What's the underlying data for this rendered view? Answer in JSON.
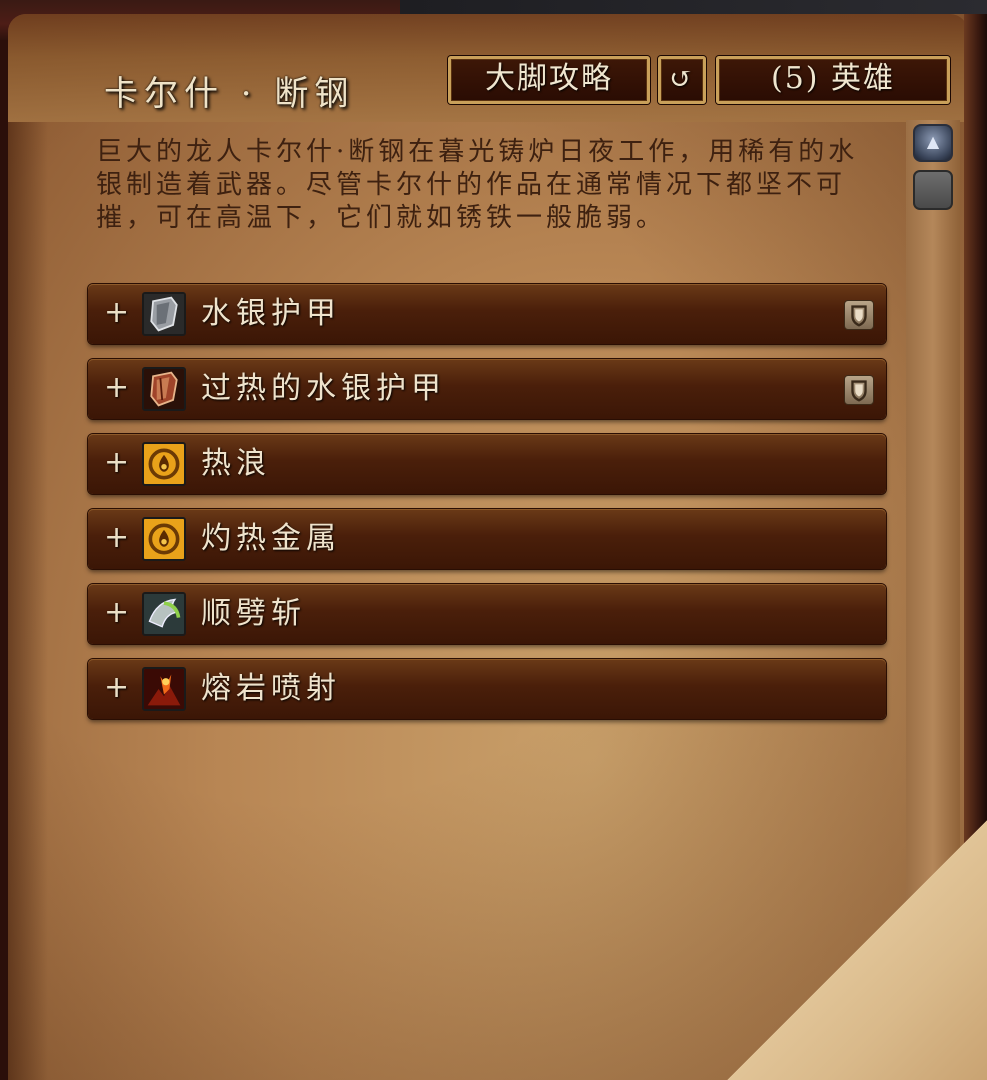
{
  "header": {
    "title": "卡尔什 · 断钢",
    "guide_button": "大脚攻略",
    "reset_button_icon": "↺",
    "difficulty_button": "(5) 英雄"
  },
  "description": "巨大的龙人卡尔什·断钢在暮光铸炉日夜工作，用稀有的水银制造着武器。尽管卡尔什的作品在通常情况下都坚不可摧，可在高温下，它们就如锈铁一般脆弱。",
  "scroll_up_icon": "▲",
  "abilities": [
    {
      "expand": "+",
      "label": "水银护甲",
      "icon": "grey-shield-icon",
      "tank_badge": true
    },
    {
      "expand": "+",
      "label": "过热的水银护甲",
      "icon": "red-shield-icon",
      "tank_badge": true
    },
    {
      "expand": "+",
      "label": "热浪",
      "icon": "fire-drop-icon",
      "tank_badge": false
    },
    {
      "expand": "+",
      "label": "灼热金属",
      "icon": "fire-drop-icon",
      "tank_badge": false
    },
    {
      "expand": "+",
      "label": "顺劈斩",
      "icon": "cleave-icon",
      "tank_badge": false
    },
    {
      "expand": "+",
      "label": "熔岩喷射",
      "icon": "lava-burst-icon",
      "tank_badge": false
    }
  ]
}
